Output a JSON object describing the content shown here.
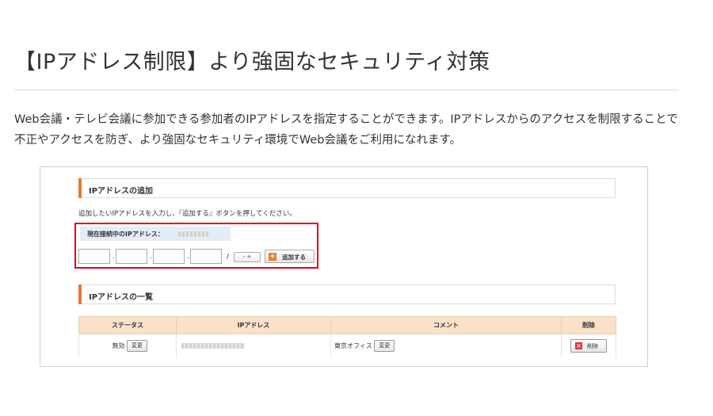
{
  "page": {
    "title": "【IPアドレス制限】より強固なセキュリティ対策",
    "intro": "Web会議・テレビ会議に参加できる参加者のIPアドレスを指定することができます。IPアドレスからのアクセスを制限することで不正やアクセスを防ぎ、より強固なセキュリティ環境でWeb会議をご利用になれます。"
  },
  "screenshot": {
    "add_section": {
      "heading": "IPアドレスの追加",
      "instruction": "追加したいIPアドレスを入力し、『追加する』ボタンを押してください。",
      "current_ip_label": "現在接続中のIPアドレス：",
      "separator_dot": ".",
      "separator_slash": "/",
      "mask_select_value": "-",
      "mask_select_arrow": "÷",
      "add_icon": "+",
      "add_button": "追加する",
      "accent_color": "#e8792a",
      "highlight_border_color": "#e60012"
    },
    "list_section": {
      "heading": "IPアドレスの一覧",
      "columns": [
        "ステータス",
        "IPアドレス",
        "コメント",
        "削除"
      ],
      "rows": [
        {
          "status": "無効",
          "status_button": "変更",
          "comment": "東京オフィス",
          "comment_button": "変更",
          "delete_icon": "×",
          "delete_button": "削除"
        }
      ],
      "header_color": "#fbe1c8"
    }
  }
}
